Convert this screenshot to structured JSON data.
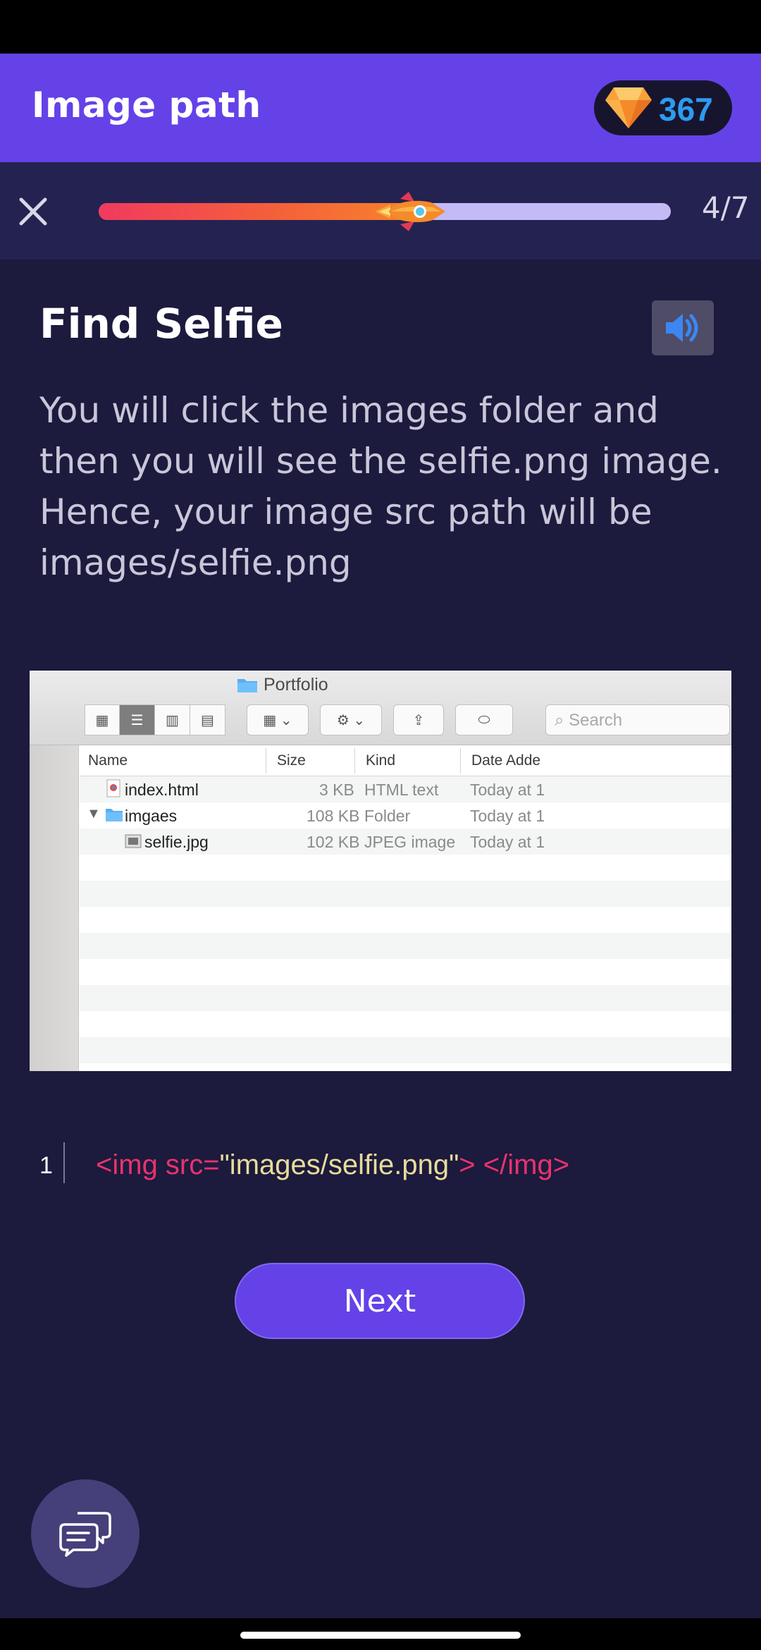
{
  "header": {
    "title": "Image path",
    "gems": "367"
  },
  "progress": {
    "step_label": "4/7",
    "current_step": 4,
    "total_steps": 7,
    "fill_fraction": 0.57
  },
  "lesson": {
    "title": "Find Selfie",
    "body": "You will click the images folder and then you will see the selfie.png image. Hence, your image src path will be images/selfie.png"
  },
  "finder": {
    "window_title": "Portfolio",
    "search_placeholder": "Search",
    "columns": [
      "Name",
      "Size",
      "Kind",
      "Date Adde"
    ],
    "rows": [
      {
        "name": "index.html",
        "size": "3 KB",
        "kind": "HTML text",
        "date": "Today at 1"
      },
      {
        "name": "imgaes",
        "size": "108 KB",
        "kind": "Folder",
        "date": "Today at 1"
      },
      {
        "name": "selfie.jpg",
        "size": "102 KB",
        "kind": "JPEG image",
        "date": "Today at 1"
      }
    ]
  },
  "code": {
    "line_number": "1",
    "tag_open": "<img src=",
    "string": "\"images/selfie.png\"",
    "tag_close": "> </img>"
  },
  "actions": {
    "next_label": "Next"
  },
  "colors": {
    "header_bg": "#6442e8",
    "page_bg": "#1c1a3d",
    "progress_strip_bg": "#242250",
    "gem_count": "#2d9bf0",
    "code_tag": "#e8336d",
    "code_string": "#e8dc9a"
  },
  "icons": {
    "close": "close-icon",
    "gem": "diamond-icon",
    "audio": "speaker-icon",
    "rocket": "rocket-icon",
    "chat": "chat-bubbles-icon"
  }
}
